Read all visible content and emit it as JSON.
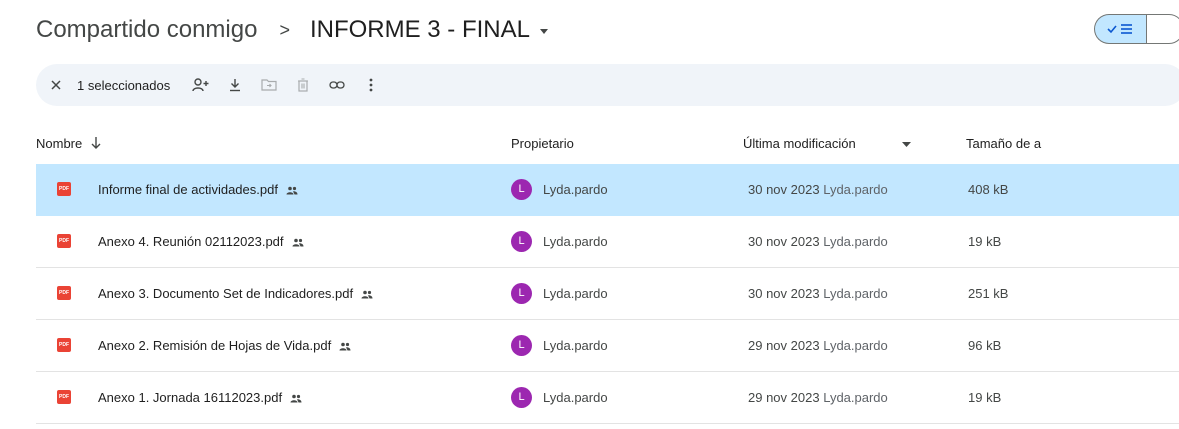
{
  "breadcrumb": {
    "root": "Compartido conmigo",
    "separator": ">",
    "current": "INFORME 3 - FINAL"
  },
  "view_toggle": {
    "list_active": true
  },
  "selection_bar": {
    "count_label": "1 seleccionados"
  },
  "columns": {
    "name": "Nombre",
    "owner": "Propietario",
    "modified": "Última modificación",
    "size": "Tamaño de a"
  },
  "files": [
    {
      "name": "Informe final de actividades.pdf",
      "owner_initial": "L",
      "owner": "Lyda.pardo",
      "date": "30 nov 2023",
      "modified_by": "Lyda.pardo",
      "size": "408 kB",
      "selected": true
    },
    {
      "name": "Anexo 4. Reunión 02112023.pdf",
      "owner_initial": "L",
      "owner": "Lyda.pardo",
      "date": "30 nov 2023",
      "modified_by": "Lyda.pardo",
      "size": "19 kB",
      "selected": false
    },
    {
      "name": "Anexo 3. Documento Set de Indicadores.pdf",
      "owner_initial": "L",
      "owner": "Lyda.pardo",
      "date": "30 nov 2023",
      "modified_by": "Lyda.pardo",
      "size": "251 kB",
      "selected": false
    },
    {
      "name": "Anexo 2. Remisión de Hojas de Vida.pdf",
      "owner_initial": "L",
      "owner": "Lyda.pardo",
      "date": "29 nov 2023",
      "modified_by": "Lyda.pardo",
      "size": "96 kB",
      "selected": false
    },
    {
      "name": "Anexo 1. Jornada 16112023.pdf",
      "owner_initial": "L",
      "owner": "Lyda.pardo",
      "date": "29 nov 2023",
      "modified_by": "Lyda.pardo",
      "size": "19 kB",
      "selected": false
    }
  ],
  "colors": {
    "selected_row": "#c2e7ff",
    "toolbar_bg": "#f0f4f9",
    "avatar": "#9c27b0",
    "pdf_icon": "#ea4335"
  },
  "icons": [
    "close-icon",
    "add-person-icon",
    "download-icon",
    "move-to-folder-icon",
    "trash-icon",
    "link-icon",
    "more-vert-icon",
    "sort-arrow-icon",
    "shared-people-icon",
    "pdf-file-icon"
  ]
}
